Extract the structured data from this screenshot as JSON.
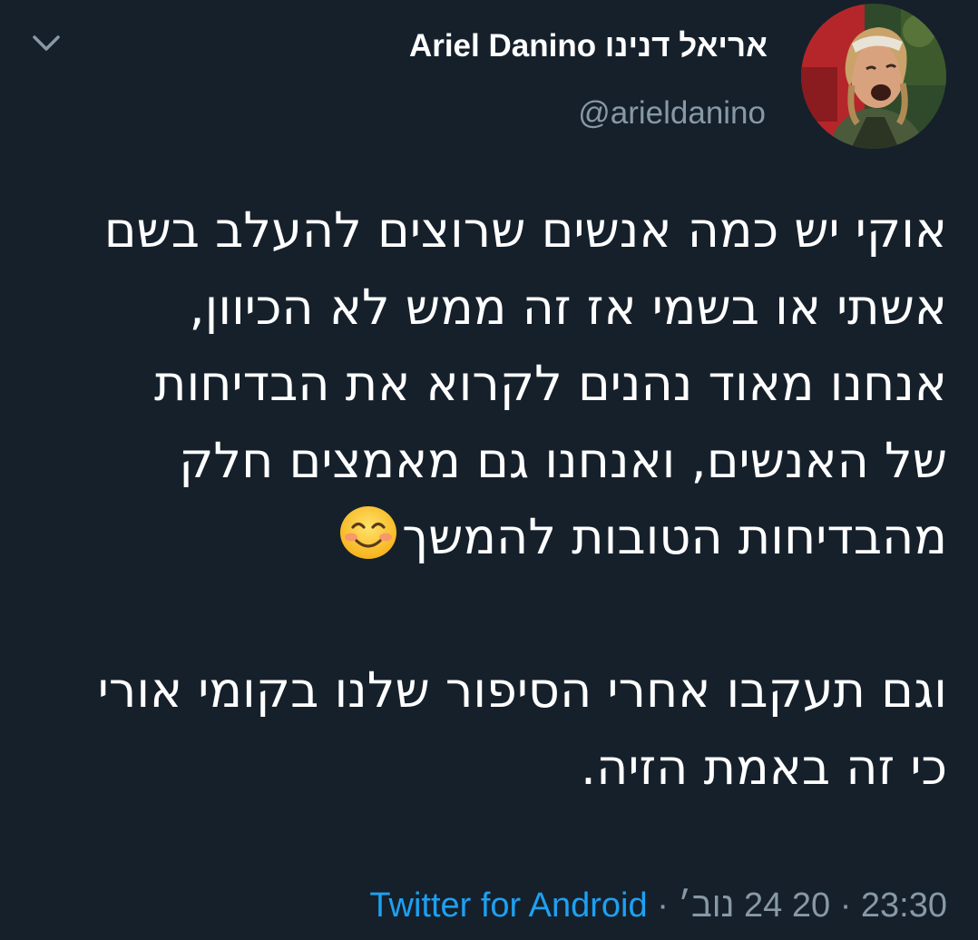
{
  "tweet": {
    "display_name": "אריאל דנינו Ariel Danino",
    "handle": "@arieldanino",
    "avatar_icon": "profile-photo",
    "collapse_icon": "chevron-down-icon",
    "body_paragraph_1": "אוקי יש כמה אנשים שרוצים להעלב בשם אשתי או בשמי אז זה ממש לא הכיוון, אנחנו מאוד נהנים לקרוא את הבדיחות של האנשים, ואנחנו גם מאמצים חלק מהבדיחות הטובות להמשך",
    "emoji": "smiling-face-with-smiling-eyes",
    "body_paragraph_2": "וגם תעקבו אחרי הסיפור שלנו בקומי אורי כי זה באמת הזיה.",
    "source": "Twitter for Android",
    "date": "20 24 נוב׳",
    "time": "23:30",
    "separator": "·"
  },
  "colors": {
    "background": "#15202b",
    "text_primary": "#ffffff",
    "text_secondary": "#8899a6",
    "link": "#1da1f2"
  }
}
